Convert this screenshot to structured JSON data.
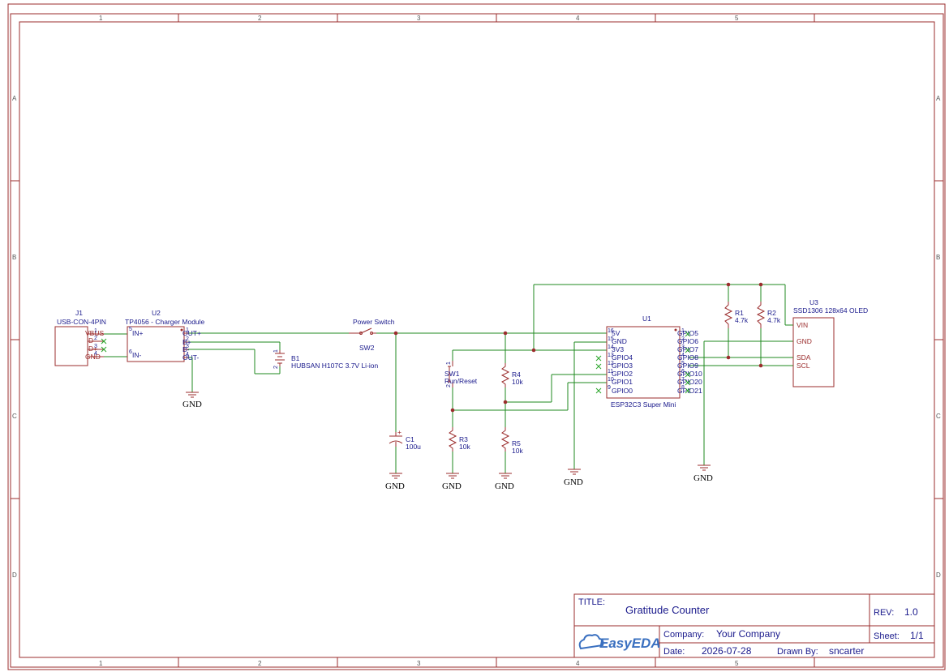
{
  "frame": {
    "cols": [
      "1",
      "2",
      "3",
      "4",
      "5"
    ],
    "rows": [
      "A",
      "B",
      "C",
      "D"
    ]
  },
  "title_block": {
    "title_label": "TITLE:",
    "title": "Gratitude Counter",
    "rev_label": "REV:",
    "rev": "1.0",
    "company_label": "Company:",
    "company": "Your Company",
    "sheet_label": "Sheet:",
    "sheet": "1/1",
    "date_label": "Date:",
    "date": "2026-07-28",
    "drawn_label": "Drawn By:",
    "drawn_by": "sncarter",
    "logo": "EasyEDA"
  },
  "components": {
    "j1": {
      "ref": "J1",
      "value": "USB-CON-4PIN",
      "pins": [
        "VBUS",
        "D-",
        "D+",
        "GND"
      ],
      "pin_numbers": [
        "1",
        "2",
        "3",
        "4"
      ]
    },
    "u2": {
      "ref": "U2",
      "value": "TP4056 - Charger Module",
      "left_pins": [
        "IN+",
        "IN-"
      ],
      "left_nums": [
        "5",
        "6"
      ],
      "right_pins": [
        "OUT+",
        "B+",
        "B-",
        "OUT-"
      ],
      "right_nums": [
        "1",
        "2",
        "3",
        "4"
      ]
    },
    "b1": {
      "ref": "B1",
      "value": "HUBSAN H107C 3.7V Li-ion",
      "pin_numbers": [
        "1",
        "2"
      ]
    },
    "sw2": {
      "ref": "SW2",
      "value": "Power Switch"
    },
    "c1": {
      "ref": "C1",
      "value": "100u"
    },
    "sw1": {
      "ref": "SW1",
      "value": "Run/Reset",
      "pin_numbers": [
        "1",
        "2"
      ]
    },
    "r3": {
      "ref": "R3",
      "value": "10k"
    },
    "r4": {
      "ref": "R4",
      "value": "10k"
    },
    "r5": {
      "ref": "R5",
      "value": "10k"
    },
    "r1": {
      "ref": "R1",
      "value": "4.7k"
    },
    "r2": {
      "ref": "R2",
      "value": "4.7k"
    },
    "u1": {
      "ref": "U1",
      "value": "ESP32C3 Super Mini",
      "left_pins": [
        "5V",
        "GND",
        "3V3",
        "GPIO4",
        "GPIO3",
        "GPIO2",
        "GPIO1",
        "GPIO0"
      ],
      "left_nums": [
        "16",
        "15",
        "14",
        "13",
        "12",
        "11",
        "10",
        "9"
      ],
      "right_pins": [
        "GPIO5",
        "GPIO6",
        "GPIO7",
        "GPIO8",
        "GPIO9",
        "GPIO10",
        "GPIO20",
        "GPIO21"
      ],
      "right_nums": [
        "1",
        "2",
        "3",
        "4",
        "5",
        "6",
        "7",
        "8"
      ]
    },
    "u3": {
      "ref": "U3",
      "value": "SSD1306 128x64 OLED",
      "pins": [
        "VIN",
        "GND",
        "SDA",
        "SCL"
      ]
    }
  },
  "gnd_label": "GND"
}
